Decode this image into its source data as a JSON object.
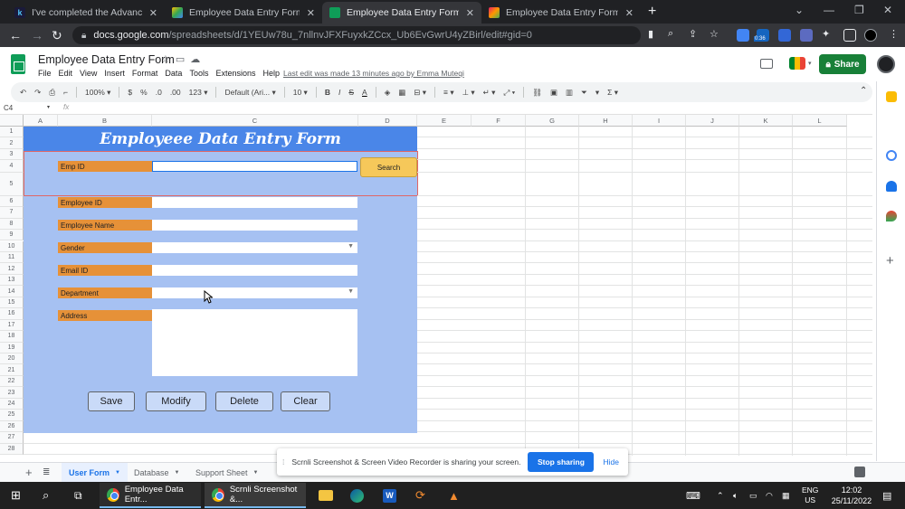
{
  "browser": {
    "tabs": [
      {
        "label": "I've completed the Advanced SQ",
        "favicon_letter": "k",
        "favicon_color": "#1a1a3a",
        "active": false
      },
      {
        "label": "Employee Data Entry Form - Goo",
        "favicon_letter": "",
        "favicon_color": "#fbbc04",
        "active": false
      },
      {
        "label": "Employee Data Entry Form - Goo",
        "favicon_letter": "",
        "favicon_color": "#0f9d58",
        "active": true
      },
      {
        "label": "Employee Data Entry Form - Proj",
        "favicon_letter": "",
        "favicon_color": "#c2185b",
        "active": false
      }
    ],
    "url_host": "docs.google.com",
    "url_path": "/spreadsheets/d/1YEUw78u_7nllnvJFXFuyxkZCcx_Ub6EvGwrU4yZBirl/edit#gid=0",
    "timer_badge": "0:36"
  },
  "doc": {
    "title": "Employee Data Entry Form",
    "menu": [
      "File",
      "Edit",
      "View",
      "Insert",
      "Format",
      "Data",
      "Tools",
      "Extensions",
      "Help"
    ],
    "last_edit": "Last edit was made 13 minutes ago by Emma Muteqi",
    "share_label": "Share"
  },
  "toolbar": {
    "zoom": "100%",
    "currency": "$",
    "percent": "%",
    "dec_less": ".0",
    "dec_more": ".00",
    "format_more": "123",
    "font": "Default (Ari...",
    "font_size": "10"
  },
  "formula_bar": {
    "cell_ref": "C4",
    "fx": "fx"
  },
  "grid": {
    "columns": [
      "A",
      "B",
      "C",
      "D",
      "E",
      "F",
      "G",
      "H",
      "I",
      "J",
      "K",
      "L"
    ],
    "rows": [
      "1",
      "2",
      "3",
      "4",
      "5",
      "6",
      "7",
      "8",
      "9",
      "10",
      "11",
      "12",
      "13",
      "14",
      "15",
      "16",
      "17",
      "18",
      "19",
      "20",
      "21",
      "22",
      "23",
      "24",
      "25",
      "26",
      "27",
      "28"
    ]
  },
  "form": {
    "title": "Employeee Data Entry Form",
    "search_label": "Emp ID",
    "search_button": "Search",
    "fields": {
      "employee_id": "Employee ID",
      "employee_name": "Employee Name",
      "gender": "Gender",
      "email_id": "Email ID",
      "department": "Department",
      "address": "Address"
    },
    "buttons": {
      "save": "Save",
      "modify": "Modify",
      "delete": "Delete",
      "clear": "Clear"
    },
    "colors": {
      "title_bg": "#4a86e8",
      "form_bg": "#a6c1f2",
      "label_bg": "#e69138"
    }
  },
  "sheet_tabs": [
    {
      "label": "User Form",
      "active": true
    },
    {
      "label": "Database",
      "active": false
    },
    {
      "label": "Support Sheet",
      "active": false
    }
  ],
  "share_notification": {
    "message": "Scrnli Screenshot & Screen Video Recorder is sharing your screen.",
    "stop_label": "Stop sharing",
    "hide_label": "Hide"
  },
  "taskbar": {
    "apps": [
      {
        "label": "Employee Data Entr..."
      },
      {
        "label": "Scrnli Screenshot &..."
      }
    ],
    "language": "ENG",
    "region": "US",
    "time": "12:02",
    "date": "25/11/2022"
  }
}
